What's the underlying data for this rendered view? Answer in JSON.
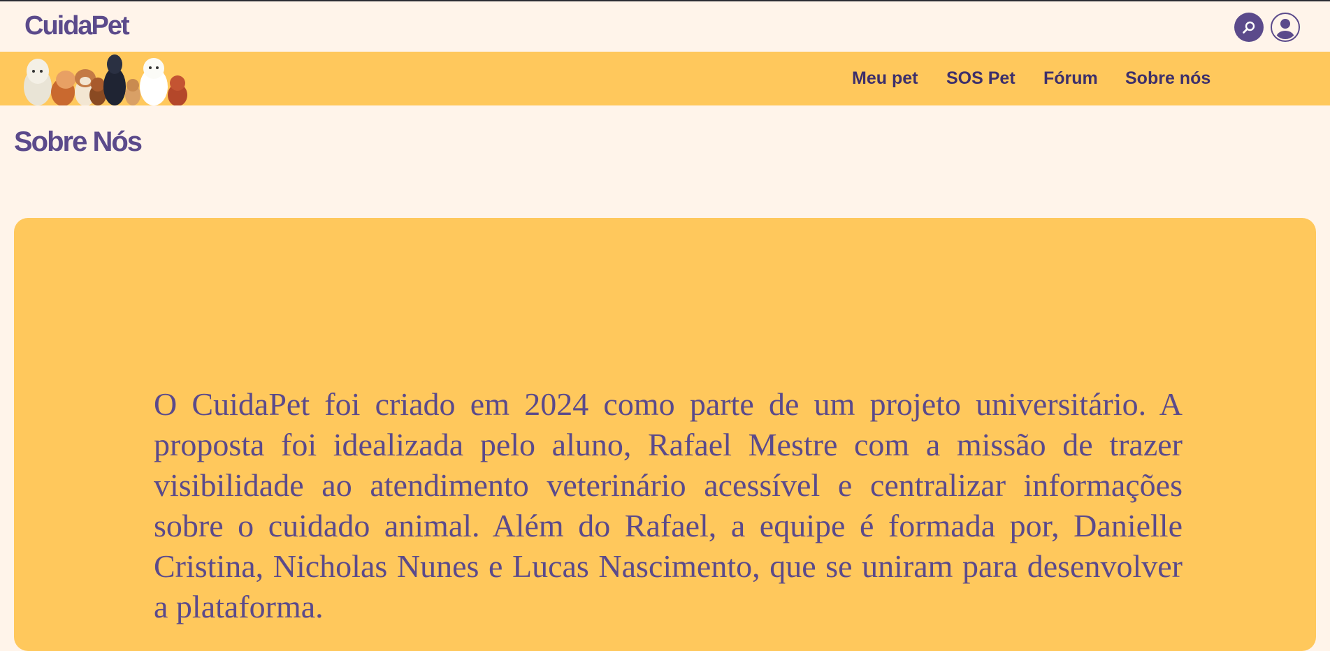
{
  "header": {
    "logo": "CuidaPet",
    "search_icon": "search-icon",
    "user_icon": "user-icon"
  },
  "nav": {
    "items": [
      {
        "label": "Meu pet"
      },
      {
        "label": "SOS Pet"
      },
      {
        "label": "Fórum"
      },
      {
        "label": "Sobre nós"
      }
    ]
  },
  "main": {
    "title": "Sobre Nós",
    "about_text": "O CuidaPet foi criado em 2024 como parte de um projeto universitário. A proposta foi idealizada pelo aluno, Rafael Mestre com a missão de trazer visibilidade ao atendimento veterinário acessível e centralizar informações sobre o cuidado animal. Além do Rafael, a equipe é formada por, Danielle Cristina, Nicholas Nunes e Lucas Nascimento, que se uniram para desenvolver a plataforma."
  },
  "colors": {
    "background": "#fff4ea",
    "accent_yellow": "#ffc85c",
    "brand_purple": "#5b4a8b",
    "nav_text": "#3d2f6b"
  }
}
